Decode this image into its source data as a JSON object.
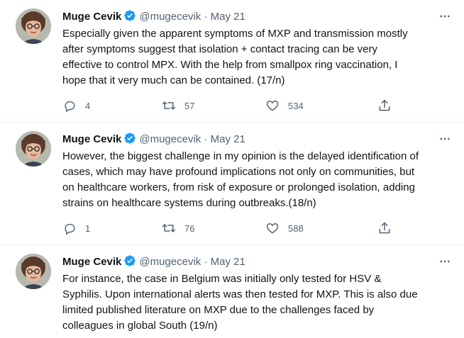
{
  "tweets": [
    {
      "author": "Muge Cevik",
      "handle": "@mugecevik",
      "separator": "·",
      "date": "May 21",
      "text": "Especially given the apparent symptoms of MXP and transmission mostly\nafter symptoms suggest that isolation + contact tracing can be very\neffective to control MPX. With the help from smallpox ring vaccination, I\nhope that it very much can be contained. (17/n)",
      "replies": "4",
      "retweets": "57",
      "likes": "534"
    },
    {
      "author": "Muge Cevik",
      "handle": "@mugecevik",
      "separator": "·",
      "date": "May 21",
      "text": "However, the biggest challenge in my opinion is the delayed identification of\ncases, which may have profound implications not only on communities, but\non healthcare workers, from risk of exposure or prolonged isolation, adding\nstrains on healthcare systems during outbreaks.(18/n)",
      "replies": "1",
      "retweets": "76",
      "likes": "588"
    },
    {
      "author": "Muge Cevik",
      "handle": "@mugecevik",
      "separator": "·",
      "date": "May 21",
      "text": "For instance, the case in Belgium was initially only tested for HSV &\nSyphilis. Upon international alerts was then tested for MXP. This is also due\nlimited published literature on MXP due to the challenges faced by\ncolleagues in global South (19/n)"
    }
  ],
  "colors": {
    "text": "#0f1419",
    "secondary": "#536471",
    "verified": "#1d9bf0",
    "divider": "#eff3f4"
  },
  "icons": [
    "verified-badge-icon",
    "more-icon",
    "reply-icon",
    "retweet-icon",
    "like-icon",
    "share-icon"
  ]
}
